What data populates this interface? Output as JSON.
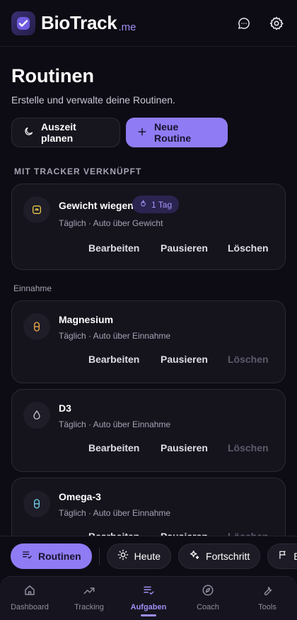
{
  "header": {
    "brand": "BioTrack",
    "brand_suffix": ".me"
  },
  "page": {
    "title": "Routinen",
    "subtitle": "Erstelle und verwalte deine Routinen."
  },
  "actions": {
    "timeout_label": "Auszeit planen",
    "new_label": "Neue Routine"
  },
  "sections": {
    "linked": "MIT TRACKER VERKNÜPFT",
    "intake": "Einnahme"
  },
  "cards": [
    {
      "title": "Gewicht wiegen",
      "streak": "1 Tag",
      "meta": "Täglich · Auto über Gewicht",
      "edit": "Bearbeiten",
      "pause": "Pausieren",
      "delete": "Löschen",
      "icon": "scale-icon"
    },
    {
      "title": "Magnesium",
      "meta": "Täglich · Auto über Einnahme",
      "edit": "Bearbeiten",
      "pause": "Pausieren",
      "delete": "Löschen",
      "icon": "capsule-icon"
    },
    {
      "title": "D3",
      "meta": "Täglich · Auto über Einnahme",
      "edit": "Bearbeiten",
      "pause": "Pausieren",
      "delete": "Löschen",
      "icon": "drop-icon"
    },
    {
      "title": "Omega-3",
      "meta": "Täglich · Auto über Einnahme",
      "edit": "Bearbeiten",
      "pause": "Pausieren",
      "delete": "Löschen",
      "icon": "capsule-icon"
    }
  ],
  "quicknav": [
    {
      "label": "Routinen",
      "icon": "list-check-icon",
      "active": true
    },
    {
      "label": "Heute",
      "icon": "sun-icon"
    },
    {
      "label": "Fortschritt",
      "icon": "sparkles-icon"
    },
    {
      "label": "En",
      "icon": "flag-icon"
    }
  ],
  "tabs": [
    {
      "label": "Dashboard",
      "icon": "home-icon"
    },
    {
      "label": "Tracking",
      "icon": "chart-line-icon"
    },
    {
      "label": "Aufgaben",
      "icon": "list-check-icon",
      "active": true
    },
    {
      "label": "Coach",
      "icon": "compass-icon"
    },
    {
      "label": "Tools",
      "icon": "wrench-icon"
    }
  ],
  "colors": {
    "accent": "#8f7cf4",
    "background": "#0d0c14",
    "card": "#15141d"
  }
}
